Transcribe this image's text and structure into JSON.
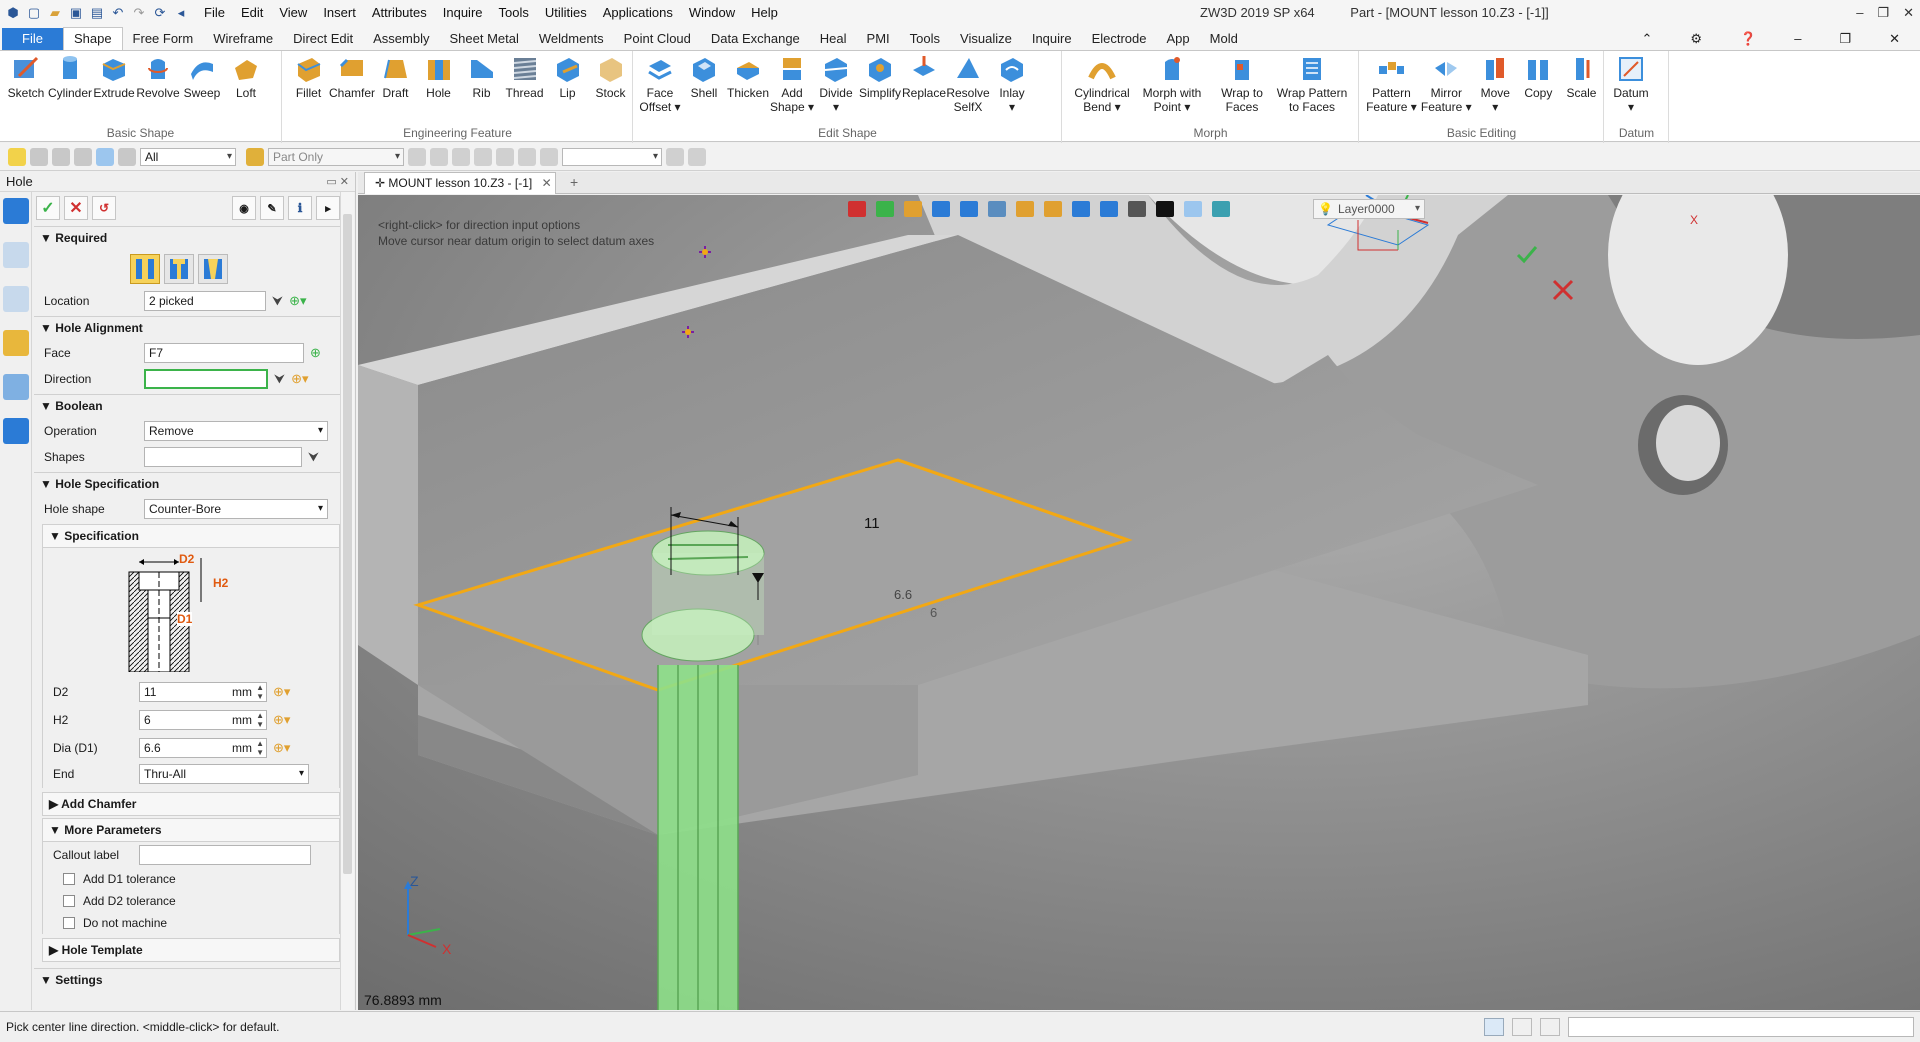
{
  "app": {
    "title": "ZW3D 2019 SP x64",
    "doc_title": "Part - [MOUNT lesson 10.Z3 - [-1]]"
  },
  "menu": [
    "File",
    "Edit",
    "View",
    "Insert",
    "Attributes",
    "Inquire",
    "Tools",
    "Utilities",
    "Applications",
    "Window",
    "Help"
  ],
  "ribbon_tabs": [
    "File",
    "Shape",
    "Free Form",
    "Wireframe",
    "Direct Edit",
    "Assembly",
    "Sheet Metal",
    "Weldments",
    "Point Cloud",
    "Data Exchange",
    "Heal",
    "PMI",
    "Tools",
    "Visualize",
    "Inquire",
    "Electrode",
    "App",
    "Mold"
  ],
  "ribbon_active": "Shape",
  "groups": [
    {
      "name": "Basic Shape",
      "buttons": [
        "Sketch",
        "Cylinder",
        "Extrude",
        "Revolve",
        "Sweep",
        "Loft"
      ]
    },
    {
      "name": "Engineering Feature",
      "buttons": [
        "Fillet",
        "Chamfer",
        "Draft",
        "Hole",
        "Rib",
        "Thread",
        "Lip",
        "Stock"
      ]
    },
    {
      "name": "Edit Shape",
      "buttons": [
        "Face Offset",
        "Shell",
        "Thicken",
        "Add Shape",
        "Divide",
        "Simplify",
        "Replace",
        "Resolve SelfX",
        "Inlay"
      ]
    },
    {
      "name": "Morph",
      "buttons": [
        "Cylindrical Bend",
        "Morph with Point",
        "Wrap to Faces",
        "Wrap Pattern to Faces"
      ]
    },
    {
      "name": "Basic Editing",
      "buttons": [
        "Pattern Feature",
        "Mirror Feature",
        "Move",
        "Copy",
        "Scale"
      ]
    },
    {
      "name": "Datum",
      "buttons": [
        "Datum"
      ]
    }
  ],
  "toolbar": {
    "filter": "All",
    "scope": "Part Only"
  },
  "panel": {
    "title": "Hole",
    "sections": {
      "required": "Required",
      "alignment": "Hole Alignment",
      "boolean": "Boolean",
      "spec": "Hole Specification",
      "specification": "Specification",
      "chamfer": "Add Chamfer",
      "more": "More Parameters",
      "template": "Hole Template",
      "settings": "Settings"
    },
    "location": {
      "label": "Location",
      "value": "2 picked"
    },
    "face": {
      "label": "Face",
      "value": "F7"
    },
    "direction": {
      "label": "Direction",
      "value": ""
    },
    "operation": {
      "label": "Operation",
      "value": "Remove"
    },
    "shapes": {
      "label": "Shapes",
      "value": ""
    },
    "hole_shape": {
      "label": "Hole shape",
      "value": "Counter-Bore"
    },
    "diagram": {
      "d2": "D2",
      "h2": "H2",
      "d1": "D1"
    },
    "d2": {
      "label": "D2",
      "value": "11",
      "unit": "mm"
    },
    "h2": {
      "label": "H2",
      "value": "6",
      "unit": "mm"
    },
    "d1": {
      "label": "Dia (D1)",
      "value": "6.6",
      "unit": "mm"
    },
    "end": {
      "label": "End",
      "value": "Thru-All"
    },
    "callout": {
      "label": "Callout label",
      "value": ""
    },
    "checks": [
      "Add D1 tolerance",
      "Add D2 tolerance",
      "Do not machine"
    ]
  },
  "doc_tab": "MOUNT lesson 10.Z3 - [-1]",
  "viewport": {
    "hint1": "<right-click> for direction input options",
    "hint2": "Move cursor near datum origin to select datum axes",
    "layer": "Layer0000",
    "measure": "76.8893 mm",
    "dim_11": "11",
    "dim_66": "6.6",
    "dim_6": "6",
    "axis_x": "X",
    "axis_z": "Z"
  },
  "status": "Pick center line direction.  <middle-click> for default.",
  "colors": {
    "accent": "#2b7bd6",
    "selection": "#f2a814",
    "hole_preview": "#8ee08a",
    "ok": "#3bb34a",
    "cancel": "#d03030"
  }
}
